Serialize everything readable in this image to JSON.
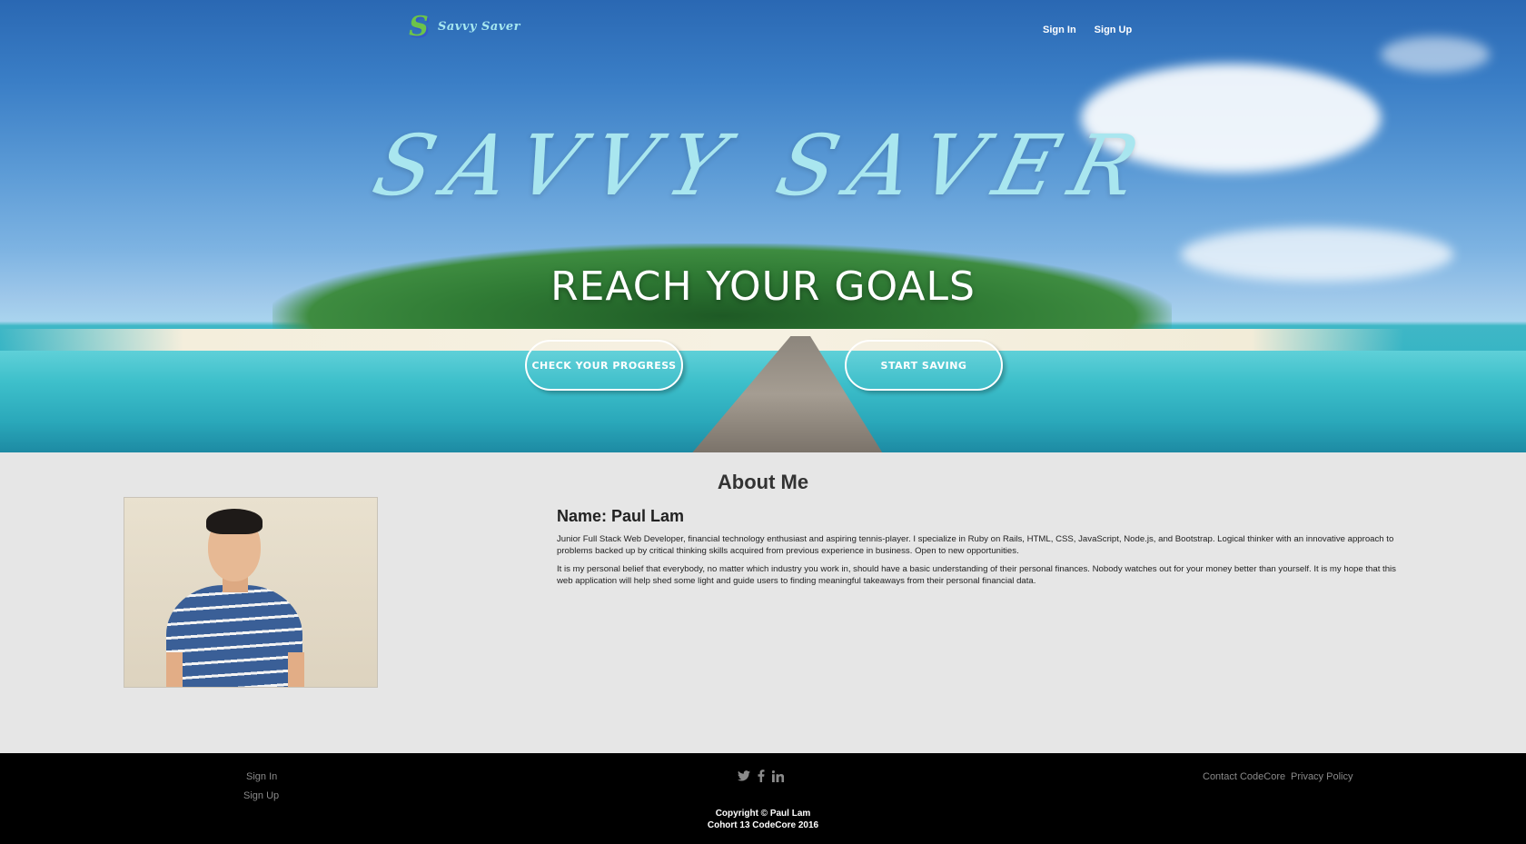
{
  "header": {
    "logo_mark": "S",
    "logo_text": "Savvy Saver",
    "nav": {
      "sign_in": "Sign In",
      "sign_up": "Sign Up"
    }
  },
  "hero": {
    "title": "SAVVY SAVER",
    "tagline": "REACH YOUR GOALS",
    "buttons": {
      "progress": "CHECK YOUR PROGRESS",
      "saving": "START SAVING"
    }
  },
  "about": {
    "heading": "About Me",
    "name": "Name: Paul Lam",
    "paragraphs": [
      "Junior Full Stack Web Developer, financial technology enthusiast and aspiring tennis-player. I specialize in Ruby on Rails, HTML, CSS, JavaScript, Node.js, and Bootstrap. Logical thinker with an innovative approach to problems backed up by critical thinking skills acquired from previous experience in business. Open to new opportunities.",
      "It is my personal belief that everybody, no matter which industry you work in, should have a basic understanding of their personal finances. Nobody watches out for your money better than yourself. It is my hope that this web application will help shed some light and guide users to finding meaningful takeaways from their personal financial data."
    ]
  },
  "footer": {
    "sign_in": "Sign In",
    "sign_up": "Sign Up",
    "contact": "Contact CodeCore",
    "privacy": "Privacy Policy",
    "social_icons": [
      "twitter-icon",
      "facebook-icon",
      "linkedin-icon"
    ],
    "copyright_line1": "Copyright © Paul Lam",
    "copyright_line2": "Cohort 13 CodeCore 2016"
  },
  "colors": {
    "logo_text": "#a6e8f0",
    "hero_title": "#a9e6ef",
    "about_bg": "#e6e6e6",
    "footer_bg": "#000000"
  }
}
